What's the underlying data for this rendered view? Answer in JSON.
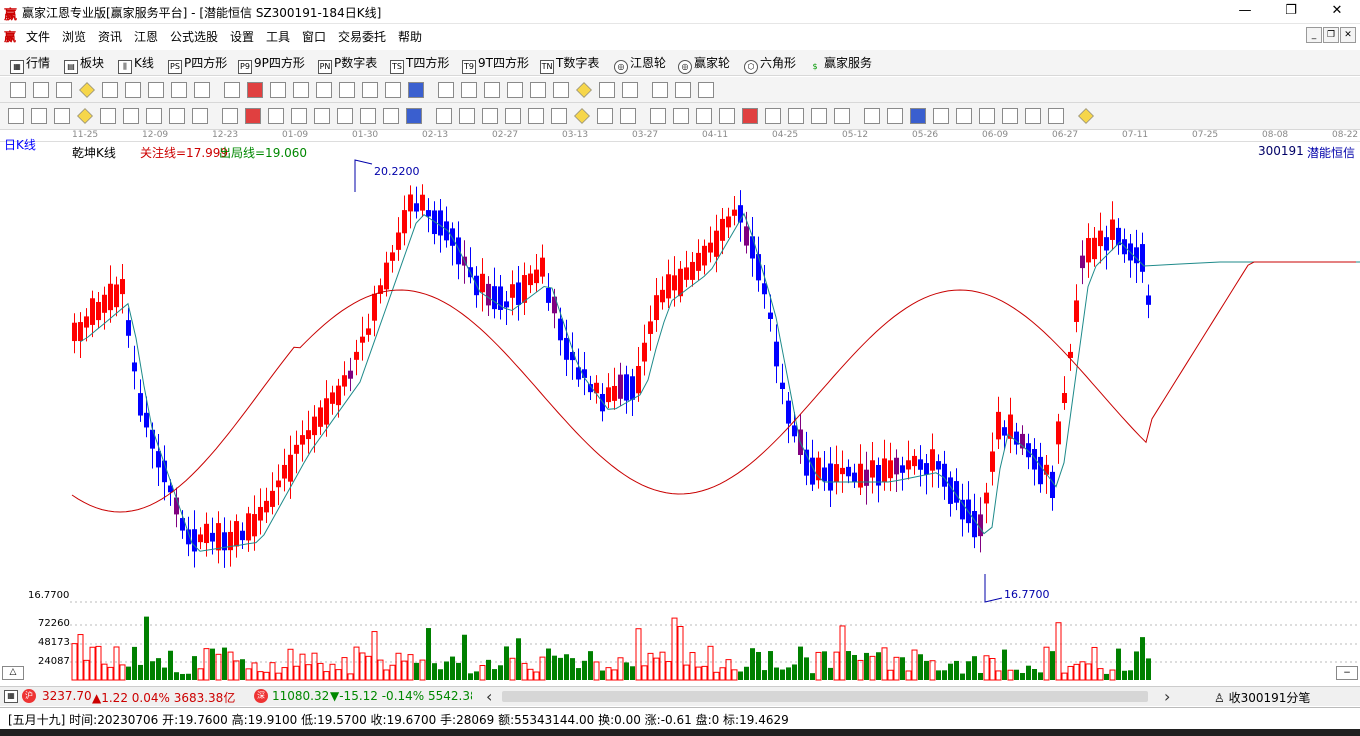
{
  "window": {
    "app_icon": "赢",
    "title": "赢家江恩专业版[赢家服务平台] - [潜能恒信  SZ300191-184日K线]",
    "minimize": "—",
    "maximize": "❐",
    "close": "✕"
  },
  "menu": [
    "文件",
    "浏览",
    "资讯",
    "江恩",
    "公式选股",
    "设置",
    "工具",
    "窗口",
    "交易委托",
    "帮助"
  ],
  "mdi_buttons": [
    "_",
    "❐",
    "✕"
  ],
  "toolbar1": [
    {
      "icon": "grid-icon",
      "label": "行情"
    },
    {
      "icon": "sector-icon",
      "label": "板块"
    },
    {
      "icon": "kline-icon",
      "label": "K线"
    },
    {
      "icon": "ps-icon",
      "label": "P四方形"
    },
    {
      "icon": "p9-icon",
      "label": "9P四方形"
    },
    {
      "icon": "pn-icon",
      "label": "P数字表"
    },
    {
      "icon": "ts-icon",
      "label": "T四方形"
    },
    {
      "icon": "t9-icon",
      "label": "9T四方形"
    },
    {
      "icon": "tn-icon",
      "label": "T数字表"
    },
    {
      "icon": "gann-wheel-icon",
      "label": "江恩轮"
    },
    {
      "icon": "winner-wheel-icon",
      "label": "赢家轮"
    },
    {
      "icon": "hexagon-icon",
      "label": "六角形"
    },
    {
      "icon": "dollar-icon",
      "label": "赢家服务"
    }
  ],
  "time_axis": [
    "11-25",
    "12-09",
    "12-23",
    "01-09",
    "01-30",
    "02-13",
    "02-27",
    "03-13",
    "03-27",
    "04-11",
    "04-25",
    "05-12",
    "05-26",
    "06-09",
    "06-27",
    "07-11",
    "07-25",
    "08-08",
    "08-22"
  ],
  "chart": {
    "period_label": "日K线",
    "indicator_name": "乾坤K线",
    "focus_line": "关注线=17.999",
    "exit_line": "出局线=19.060",
    "stock_code": "300191",
    "stock_name": "潜能恒信",
    "high_marker": "20.2200",
    "low_marker": "16.7700",
    "vol_axis": [
      "16.7700",
      "72260",
      "48173",
      "24087"
    ],
    "corner_symbol": "△"
  },
  "chart_data": {
    "type": "candlestick",
    "high": 20.22,
    "low": 16.77,
    "ma_short_color": "#1e8a8a",
    "ma_long_color": "#c80000",
    "colors": {
      "up": "#ff0000",
      "down": "#0000ff",
      "turn": "#800080",
      "vol_up": "#ff0000",
      "vol_down": "#008000"
    }
  },
  "scroll": {
    "sh_index": "3237.70",
    "sh_change": "▲1.22 0.04% 3683.38亿",
    "sz_index": "11080.32",
    "sz_change": "▼-15.12 -0.14% 5542.38",
    "left_arrow": "‹",
    "right_arrow": "›",
    "note": "收300191分笔"
  },
  "status": {
    "text": "[五月十九] 时间:20230706 开:19.7600 高:19.9100 低:19.5700 收:19.6700 手:28069 额:55343144.00 换:0.00 涨:-0.61 盘:0 标:19.4629"
  }
}
